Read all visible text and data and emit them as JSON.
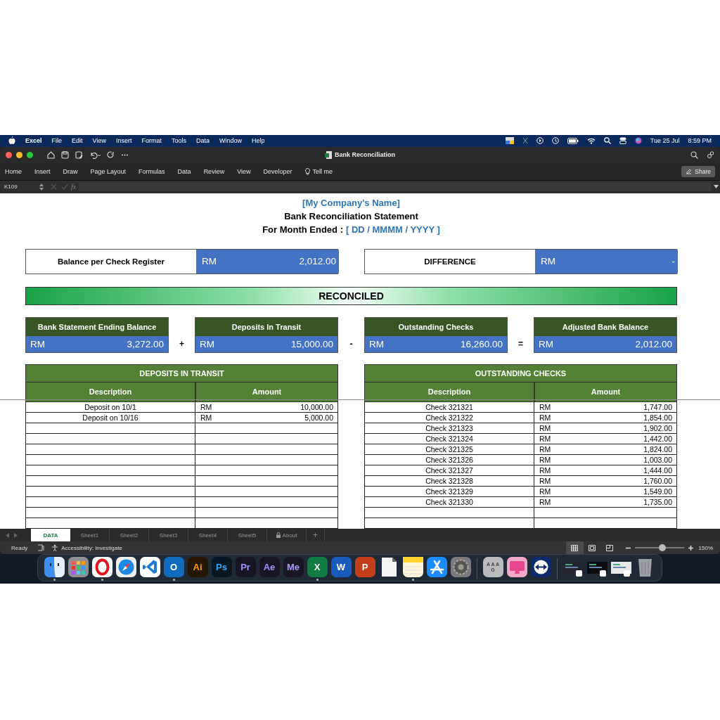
{
  "menubar": {
    "app": "Excel",
    "items": [
      "File",
      "Edit",
      "View",
      "Insert",
      "Format",
      "Tools",
      "Data",
      "Window",
      "Help"
    ],
    "date": "Tue 25 Jul",
    "time": "8:59 PM"
  },
  "window": {
    "title": "Bank Reconciliation",
    "share": "Share"
  },
  "ribbon_tabs": [
    {
      "label": "Home",
      "kind": "tab"
    },
    {
      "label": "Insert",
      "kind": "tab"
    },
    {
      "label": "Draw",
      "kind": "tab"
    },
    {
      "label": "Page Layout",
      "kind": "tab"
    },
    {
      "label": "Formulas",
      "kind": "tab"
    },
    {
      "label": "Data",
      "kind": "tab"
    },
    {
      "label": "Review",
      "kind": "tab"
    },
    {
      "label": "View",
      "kind": "tab"
    },
    {
      "label": "Developer",
      "kind": "tab"
    },
    {
      "label": "Tell me",
      "kind": "search"
    }
  ],
  "formula_bar": {
    "cell": "K109",
    "fx": "fx"
  },
  "sheet": {
    "company": "[My Company's Name]",
    "title": "Bank Reconciliation Statement",
    "month_label": "For Month Ended :",
    "month_value": "[ DD / MMMM / YYYY ]",
    "top_boxes": [
      {
        "label": "Balance per Check Register",
        "currency": "RM",
        "value": "2,012.00"
      },
      {
        "label": "DIFFERENCE",
        "currency": "RM",
        "value": "-"
      }
    ],
    "status": "RECONCILED",
    "summary": [
      {
        "label": "Bank Statement Ending Balance",
        "currency": "RM",
        "value": "3,272.00",
        "operator": "+"
      },
      {
        "label": "Deposits In Transit",
        "currency": "RM",
        "value": "15,000.00",
        "operator": "-"
      },
      {
        "label": "Outstanding Checks",
        "currency": "RM",
        "value": "16,260.00",
        "operator": "="
      },
      {
        "label": "Adjusted Bank Balance",
        "currency": "RM",
        "value": "2,012.00"
      }
    ],
    "tables": [
      {
        "title": "DEPOSITS IN TRANSIT",
        "columns": [
          "Description",
          "Amount"
        ],
        "rows": [
          {
            "description": "Deposit on 10/1",
            "currency": "RM",
            "amount": "10,000.00"
          },
          {
            "description": "Deposit on 10/16",
            "currency": "RM",
            "amount": "5,000.00"
          }
        ]
      },
      {
        "title": "OUTSTANDING CHECKS",
        "columns": [
          "Description",
          "Amount"
        ],
        "rows": [
          {
            "description": "Check 321321",
            "currency": "RM",
            "amount": "1,747.00"
          },
          {
            "description": "Check 321322",
            "currency": "RM",
            "amount": "1,854.00"
          },
          {
            "description": "Check 321323",
            "currency": "RM",
            "amount": "1,902.00"
          },
          {
            "description": "Check 321324",
            "currency": "RM",
            "amount": "1,442.00"
          },
          {
            "description": "Check 321325",
            "currency": "RM",
            "amount": "1,824.00"
          },
          {
            "description": "Check 321326",
            "currency": "RM",
            "amount": "1,003.00"
          },
          {
            "description": "Check 321327",
            "currency": "RM",
            "amount": "1,444.00"
          },
          {
            "description": "Check 321328",
            "currency": "RM",
            "amount": "1,760.00"
          },
          {
            "description": "Check 321329",
            "currency": "RM",
            "amount": "1,549.00"
          },
          {
            "description": "Check 321330",
            "currency": "RM",
            "amount": "1,735.00"
          }
        ]
      }
    ]
  },
  "sheet_tabs": [
    {
      "label": "DATA",
      "selected": true,
      "kind": "plain"
    },
    {
      "label": "Sheet1",
      "selected": false,
      "kind": "plain"
    },
    {
      "label": "Sheet2",
      "selected": false,
      "kind": "plain"
    },
    {
      "label": "Sheet3",
      "selected": false,
      "kind": "plain"
    },
    {
      "label": "Sheet4",
      "selected": false,
      "kind": "plain"
    },
    {
      "label": "Sheet5",
      "selected": false,
      "kind": "plain"
    },
    {
      "label": "About",
      "selected": false,
      "kind": "locked"
    }
  ],
  "add_tab": "+",
  "status_bar": {
    "ready": "Ready",
    "accessibility": "Accessibility: Investigate",
    "view_modes": [
      {
        "kind": "normal",
        "selected": true
      },
      {
        "kind": "page",
        "selected": false
      },
      {
        "kind": "break",
        "selected": false
      }
    ],
    "zoom": {
      "level": 0.57,
      "reading": "150%"
    }
  },
  "dock": [
    {
      "kind": "face",
      "color": "#3d8ef0",
      "running": true
    },
    {
      "kind": "grid",
      "color": "#8e8e93",
      "running": false
    },
    {
      "kind": "ring",
      "color": "#ffffff",
      "running": true
    },
    {
      "kind": "compass",
      "color": "#1e88e5",
      "running": false
    },
    {
      "kind": "chevron",
      "color": "#ffffff",
      "running": false
    },
    {
      "kind": "letter",
      "color": "#0f6cbd",
      "label": "O",
      "running": true
    },
    {
      "kind": "badge",
      "color": "#ff9a00",
      "label": "Ai",
      "running": false
    },
    {
      "kind": "badge",
      "color": "#31a8ff",
      "label": "Ps",
      "running": false
    },
    {
      "kind": "badge",
      "color": "#9999ff",
      "label": "Pr",
      "running": false
    },
    {
      "kind": "badge",
      "color": "#9999ff",
      "label": "Ae",
      "running": false
    },
    {
      "kind": "badge",
      "color": "#a8a0ff",
      "label": "Me",
      "running": false
    },
    {
      "kind": "letter",
      "color": "#107c41",
      "label": "X",
      "running": true
    },
    {
      "kind": "letter",
      "color": "#185abd",
      "label": "W",
      "running": false
    },
    {
      "kind": "letter",
      "color": "#c43e1c",
      "label": "P",
      "running": false
    },
    {
      "kind": "document",
      "color": "#f4f4f4",
      "running": false
    },
    {
      "kind": "notes",
      "color": "#fff6d8",
      "running": true
    },
    {
      "kind": "appstore",
      "color": "#1a8cff",
      "running": false
    },
    {
      "kind": "gear",
      "color": "#7a7a7a",
      "running": false
    },
    {
      "kind": "separator"
    },
    {
      "kind": "plate",
      "color": "#b8bcbf",
      "label": "A A A G",
      "running": false
    },
    {
      "kind": "monitor",
      "color": "#f2a8c8",
      "running": false
    },
    {
      "kind": "arrows",
      "color": "#0e2a6e",
      "running": false
    },
    {
      "kind": "separator"
    },
    {
      "kind": "window",
      "color": "#22262e",
      "running": false
    },
    {
      "kind": "window",
      "color": "#0c0c10",
      "running": false
    },
    {
      "kind": "window",
      "color": "#e8e8e8",
      "running": false
    },
    {
      "kind": "trash",
      "color": "#9aa0a6",
      "running": false
    }
  ]
}
